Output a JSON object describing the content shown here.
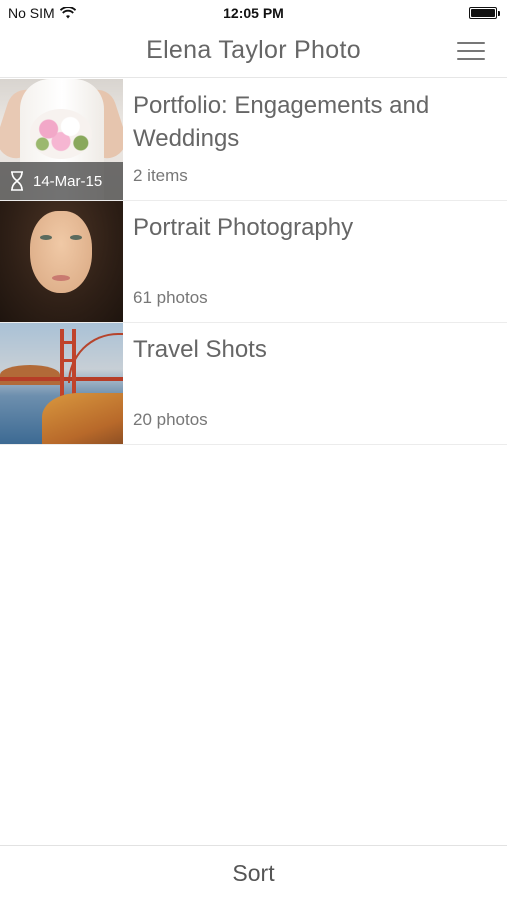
{
  "status_bar": {
    "carrier": "No SIM",
    "time": "12:05 PM",
    "wifi_icon": "wifi-icon",
    "battery_icon": "battery-icon"
  },
  "nav": {
    "title": "Elena Taylor Photo",
    "menu_icon": "hamburger-menu-icon"
  },
  "items": [
    {
      "title": "Portfolio: Engagements and Weddings",
      "subtitle": "2 items",
      "date": "14-Mar-15",
      "date_icon": "hourglass-icon"
    },
    {
      "title": "Portrait Photography",
      "subtitle": "61 photos"
    },
    {
      "title": "Travel Shots",
      "subtitle": "20 photos"
    }
  ],
  "bottom": {
    "sort_label": "Sort"
  }
}
